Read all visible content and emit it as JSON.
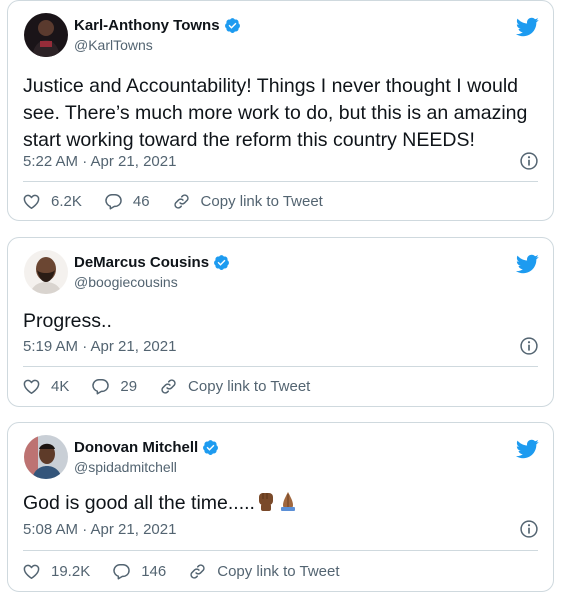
{
  "tweets": [
    {
      "name": "Karl-Anthony Towns",
      "handle": "@KarlTowns",
      "text": "Justice and Accountability! Things I never thought I would see. There’s much more work to do, but this is an amazing start working toward the reform this country NEEDS!",
      "time": "5:22 AM · Apr 21, 2021",
      "likes": "6.2K",
      "replies": "46",
      "copy": "Copy link to Tweet"
    },
    {
      "name": "DeMarcus Cousins",
      "handle": "@boogiecousins",
      "text": "Progress..",
      "time": "5:19 AM · Apr 21, 2021",
      "likes": "4K",
      "replies": "29",
      "copy": "Copy link to Tweet"
    },
    {
      "name": "Donovan Mitchell",
      "handle": "@spidadmitchell",
      "text": "God is good all the time.....",
      "time": "5:08 AM · Apr 21, 2021",
      "likes": "19.2K",
      "replies": "146",
      "copy": "Copy link to Tweet"
    }
  ],
  "colors": {
    "twitter_blue": "#1d9bf0",
    "text_primary": "#0f1419",
    "text_secondary": "#536471",
    "border": "#cfd9de"
  },
  "icons": [
    "verified-badge-icon",
    "twitter-bird-icon",
    "info-icon",
    "heart-icon",
    "reply-bubble-icon",
    "link-icon",
    "raised-fist-emoji",
    "folded-hands-emoji"
  ]
}
